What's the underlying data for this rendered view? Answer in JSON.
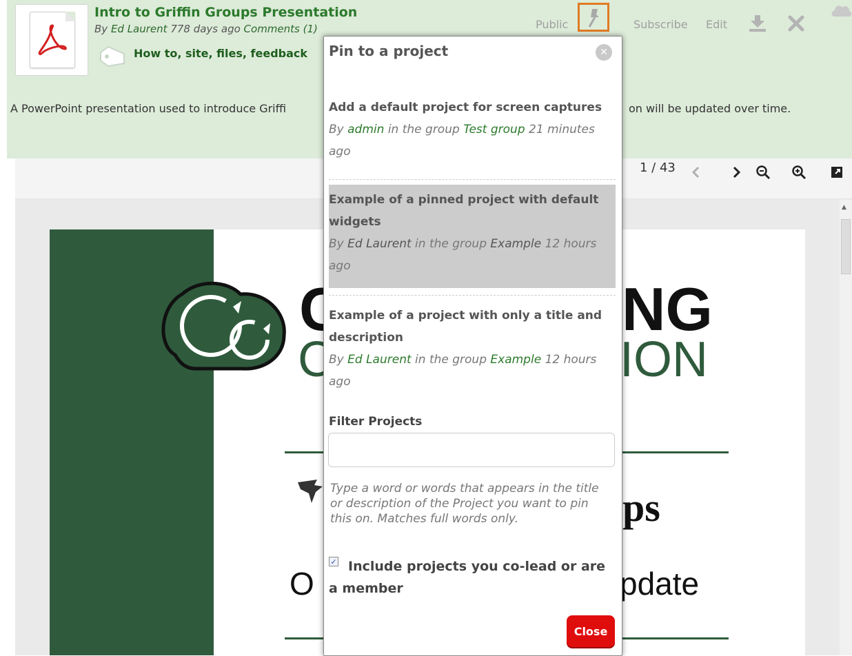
{
  "item": {
    "title": "Intro to Griffin Groups Presentation",
    "byline_prefix": "By ",
    "author": "Ed Laurent",
    "age": " 778 days ago ",
    "comments": "Comments (1)",
    "tags": "How to, site, files, feedback",
    "description_start": "A PowerPoint presentation used to introduce Griffi",
    "description_end": "on will be updated over time."
  },
  "toolbar": {
    "public_label": "Public",
    "subscribe_label": "Subscribe",
    "edit_label": "Edit",
    "pin_icon": "pin-icon",
    "download_icon": "download-icon",
    "delete_icon": "delete-icon",
    "accent_color": "#e07b23"
  },
  "viewer": {
    "page_counter": "1 / 43"
  },
  "slide_text": {
    "ng": "NG",
    "c1": "C",
    "ion": "ION",
    "c2": "C",
    "ps": "ps",
    "o": "O",
    "pdate": "pdate"
  },
  "popup": {
    "title": "Pin to a project",
    "projects": [
      {
        "title": "Add a default project for screen captures",
        "by": "By ",
        "author": "admin",
        "in_group": " in the group ",
        "group": "Test group",
        "age": " 21 minutes ago"
      },
      {
        "title": "Example of a pinned project with default widgets",
        "by": "By ",
        "author": "Ed Laurent",
        "in_group": " in the group ",
        "group": "Example",
        "age": " 12 hours ago"
      },
      {
        "title": "Example of a project with only a title and description",
        "by": "By ",
        "author": "Ed Laurent",
        "in_group": " in the group ",
        "group": "Example",
        "age": " 12 hours ago"
      }
    ],
    "filter_label": "Filter Projects",
    "filter_value": "",
    "filter_help": "Type a word or words that appears in the title or description of the Project you want to pin this on. Matches full words only.",
    "include_label": "Include projects you co-lead or are a member",
    "include_checked": true,
    "close_label": "Close",
    "close_color": "#e00d0d"
  }
}
